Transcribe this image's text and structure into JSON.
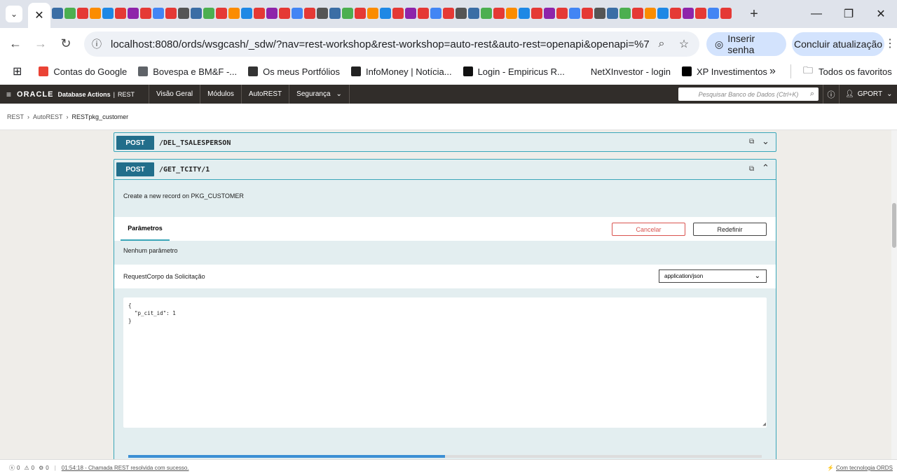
{
  "browser": {
    "address_url": "localhost:8080/ords/wsgcash/_sdw/?nav=rest-workshop&rest-workshop=auto-rest&auto-rest=openapi&openapi=%7B\"o...",
    "password_pill": "Inserir senha",
    "update_pill": "Concluir atualização",
    "bookmarks": [
      {
        "label": "Contas do Google",
        "color": "#ea4335"
      },
      {
        "label": "Bovespa e BM&F -...",
        "color": "#5f6368"
      },
      {
        "label": "Os meus Portfólios",
        "color": "#333333"
      },
      {
        "label": "InfoMoney | Notícia...",
        "color": "#222222"
      },
      {
        "label": "Login - Empiricus R...",
        "color": "#111111"
      },
      {
        "label": "NetXInvestor - login",
        "color": "#ffffff"
      },
      {
        "label": "XP Investimentos",
        "color": "#000000"
      }
    ],
    "all_bookmarks": "Todos os favoritos"
  },
  "oracle": {
    "brand": "ORACLE",
    "product": "Database Actions",
    "section": "REST",
    "nav": [
      "Visão Geral",
      "Módulos",
      "AutoREST",
      "Segurança"
    ],
    "search_placeholder": "Pesquisar Banco de Dados (Ctrl+K)",
    "user": "GPORT"
  },
  "breadcrumb": [
    "REST",
    "AutoREST",
    "RESTpkg_customer"
  ],
  "endpoints": [
    {
      "method": "POST",
      "path": "/DEL_TSALESPERSON"
    },
    {
      "method": "POST",
      "path": "/GET_TCITY/1"
    }
  ],
  "detail": {
    "description": "Create a new record on PKG_CUSTOMER",
    "params_tab": "Parâmetros",
    "cancel": "Cancelar",
    "reset": "Redefinir",
    "no_params": "Nenhum parâmetro",
    "request_body_label": "RequestCorpo da Solicitação",
    "content_type": "application/json",
    "body_lines": [
      "{",
      "  \"p_cit_id\": 1",
      "}"
    ]
  },
  "status": {
    "errors": "0",
    "warnings": "0",
    "jobs": "0",
    "message": "01:54:18 - Chamada REST resolvida com sucesso.",
    "powered": "Com tecnologia ORDS"
  }
}
